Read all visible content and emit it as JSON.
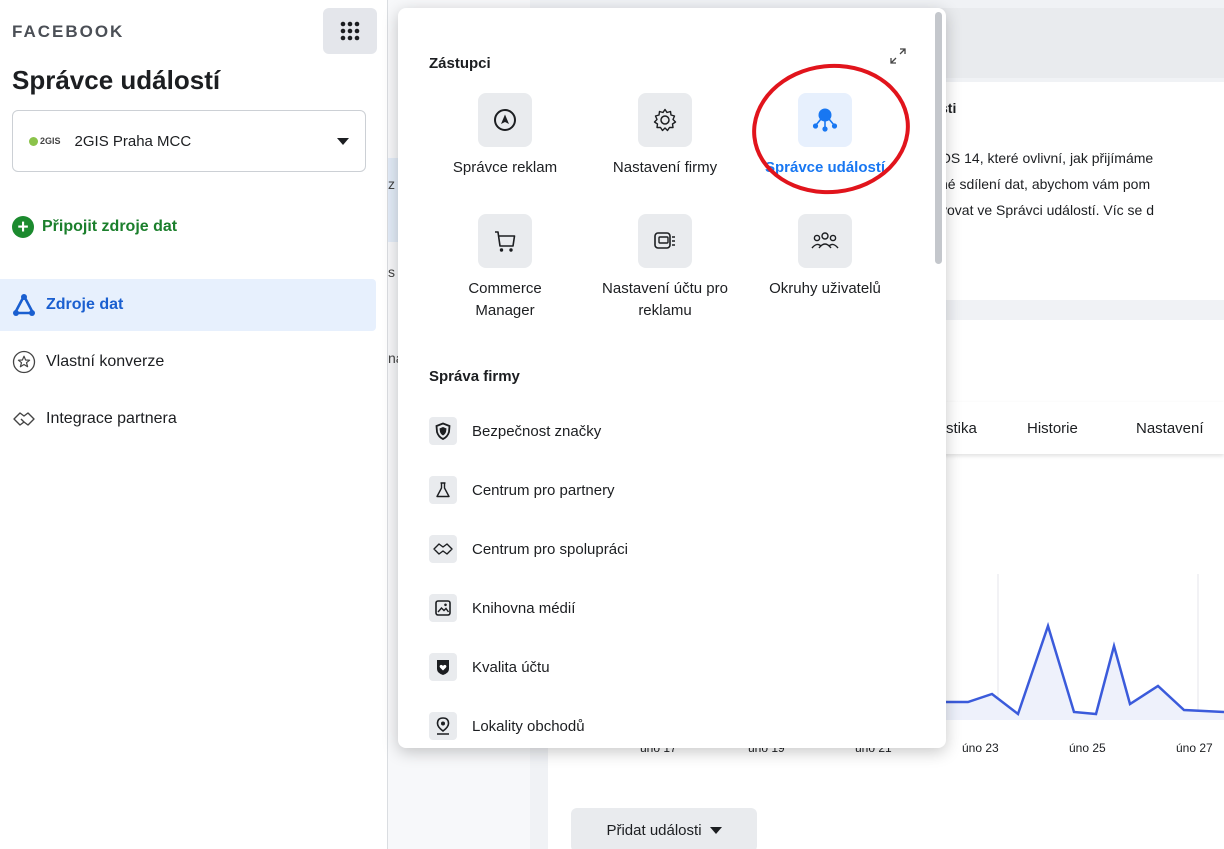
{
  "sidebar": {
    "brand": "FACEBOOK",
    "title": "Správce událostí",
    "account": {
      "logo": "2GIS",
      "name": "2GIS Praha MCC"
    },
    "connect_label": "Připojit zdroje dat",
    "nav": [
      {
        "label": "Zdroje dat",
        "icon": "data-sources-icon",
        "active": true
      },
      {
        "label": "Vlastní konverze",
        "icon": "star-circle-icon",
        "active": false
      },
      {
        "label": "Integrace partnera",
        "icon": "handshake-icon",
        "active": false
      }
    ]
  },
  "popover": {
    "section_tools": "Zástupci",
    "tools": [
      {
        "label": "Správce reklam",
        "icon": "navigation-arrow-icon"
      },
      {
        "label": "Nastavení firmy",
        "icon": "gear-icon"
      },
      {
        "label": "Správce událostí",
        "icon": "events-manager-icon",
        "selected": true
      },
      {
        "label": "Commerce Manager",
        "icon": "cart-icon"
      },
      {
        "label": "Nastavení účtu pro reklamu",
        "icon": "ad-account-icon"
      },
      {
        "label": "Okruhy uživatelů",
        "icon": "audiences-icon"
      }
    ],
    "section_business": "Správa firmy",
    "business_items": [
      {
        "label": "Bezpečnost značky",
        "icon": "shield-icon"
      },
      {
        "label": "Centrum pro partnery",
        "icon": "flask-icon"
      },
      {
        "label": "Centrum pro spolupráci",
        "icon": "handshake-icon"
      },
      {
        "label": "Knihovna médií",
        "icon": "media-library-icon"
      },
      {
        "label": "Kvalita účtu",
        "icon": "account-quality-icon"
      },
      {
        "label": "Lokality obchodů",
        "icon": "location-pin-icon"
      }
    ]
  },
  "background": {
    "card_title_fragment": "sti",
    "card_lines": [
      "OS 14, které ovlivní, jak přijímáme",
      "né sdílení dat, abychom vám pom",
      "vovat ve Správci událostí. Víc se d"
    ],
    "left_frags": [
      "z",
      "s",
      "na"
    ],
    "tabs": [
      "stika",
      "Historie",
      "Nastavení"
    ],
    "axis_labels": [
      "úno 17",
      "úno 19",
      "úno 21",
      "úno 23",
      "úno 25",
      "úno 27"
    ],
    "add_events_label": "Přidat události"
  },
  "colors": {
    "accent": "#1877f2",
    "active_nav": "#1a5fd0",
    "connect_green": "#1b7f2c",
    "annotation_red": "#e1141c"
  }
}
